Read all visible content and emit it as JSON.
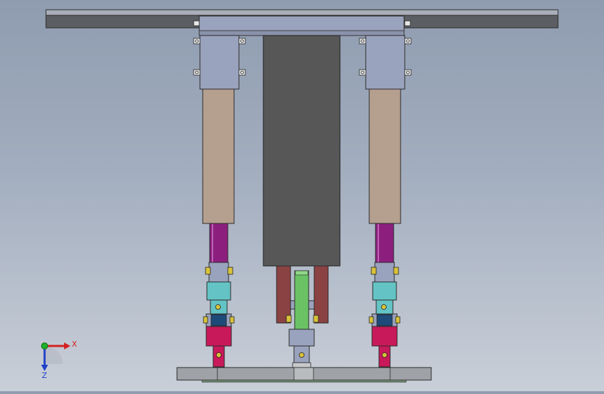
{
  "viewport": {
    "background_top": "#8f9cb0",
    "background_bottom": "#c9cfd8"
  },
  "triad": {
    "x_label": "X",
    "z_label": "Z",
    "x_color": "#d42020",
    "y_color": "#1fae2a",
    "z_color": "#2040c8"
  },
  "colors": {
    "plate": "#5b5e63",
    "bracket": "#9aa3bd",
    "cylinder_body": "#b59f8f",
    "rod": "#8c1f7e",
    "joint_block": "#64c3c4",
    "joint_base": "#c8195a",
    "motor_housing": "#575757",
    "coupling": "#8b4242",
    "screw": "#6ac264",
    "base_plate": "#9fa3a7",
    "yellow_pin": "#d8c23a"
  }
}
